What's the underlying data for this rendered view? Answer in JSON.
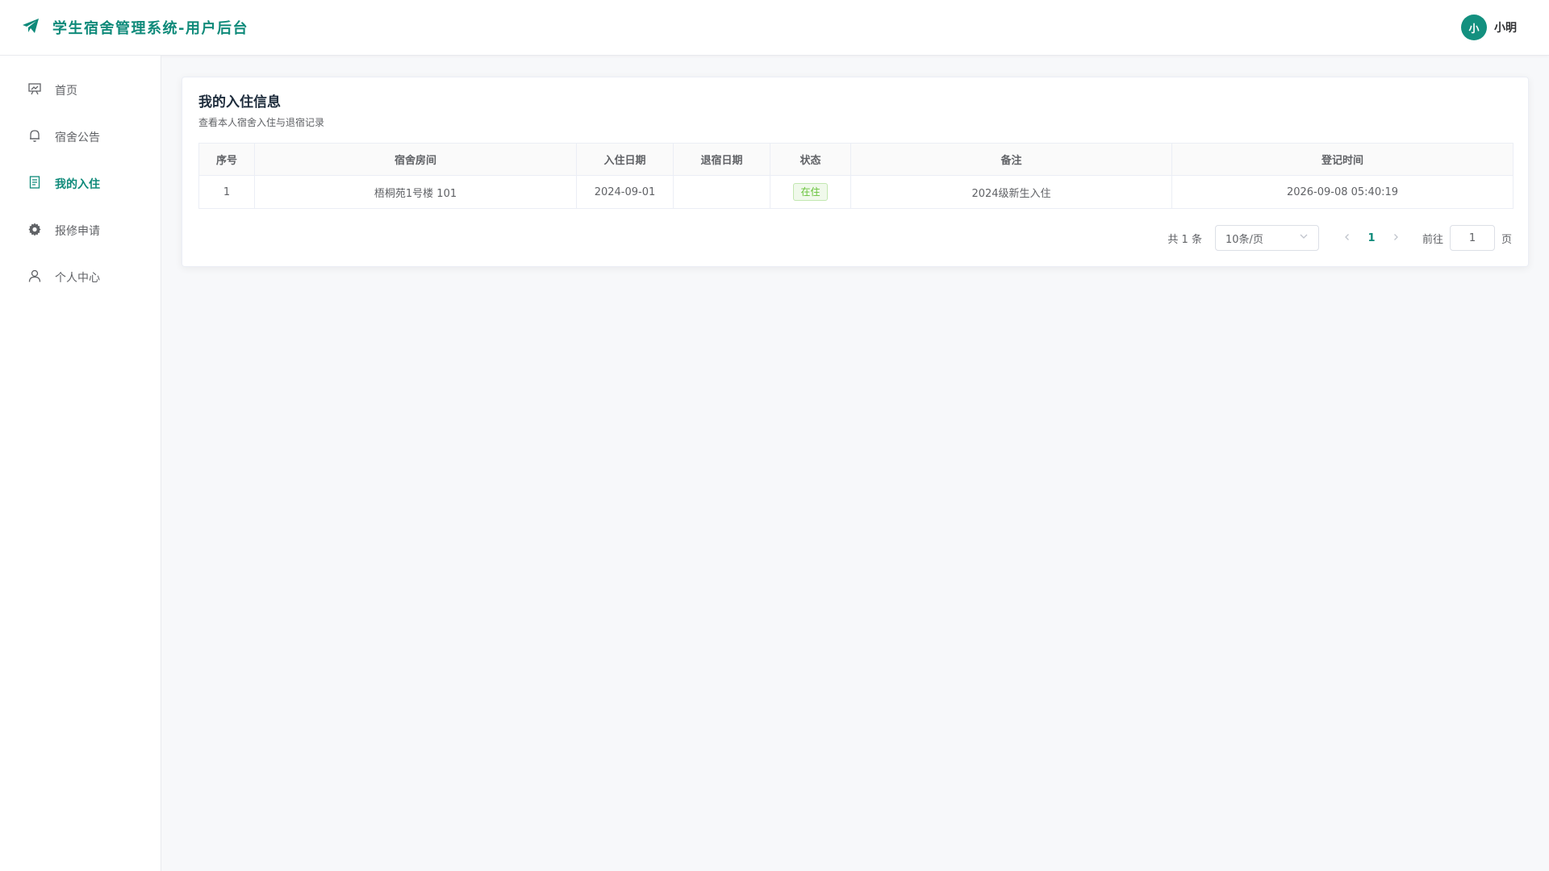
{
  "header": {
    "title": "学生宿舍管理系统-用户后台",
    "brand_icon": "paper-plane-icon",
    "avatar_text": "小",
    "user_name": "小明"
  },
  "sidebar": {
    "items": [
      {
        "label": "首页",
        "icon": "dashboard-icon",
        "active": false
      },
      {
        "label": "宿舍公告",
        "icon": "bell-icon",
        "active": false
      },
      {
        "label": "我的入住",
        "icon": "document-icon",
        "active": true
      },
      {
        "label": "报修申请",
        "icon": "gear-icon",
        "active": false
      },
      {
        "label": "个人中心",
        "icon": "user-icon",
        "active": false
      }
    ]
  },
  "main": {
    "title": "我的入住信息",
    "subtitle": "查看本人宿舍入住与退宿记录",
    "table": {
      "columns": [
        "序号",
        "宿舍房间",
        "入住日期",
        "退宿日期",
        "状态",
        "备注",
        "登记时间"
      ],
      "rows": [
        {
          "index": "1",
          "room": "梧桐苑1号楼 101",
          "checkin": "2024-09-01",
          "checkout": "",
          "status": "在住",
          "remark": "2024级新生入住",
          "created": "2026-09-08 05:40:19"
        }
      ]
    },
    "pagination": {
      "total": "共 1 条",
      "page_size": "10条/页",
      "current_page": "1",
      "goto_label": "前往",
      "goto_value": "1",
      "goto_suffix": "页"
    }
  },
  "colors": {
    "accent": "#0f8a7a",
    "status_success": "#67c23a"
  }
}
